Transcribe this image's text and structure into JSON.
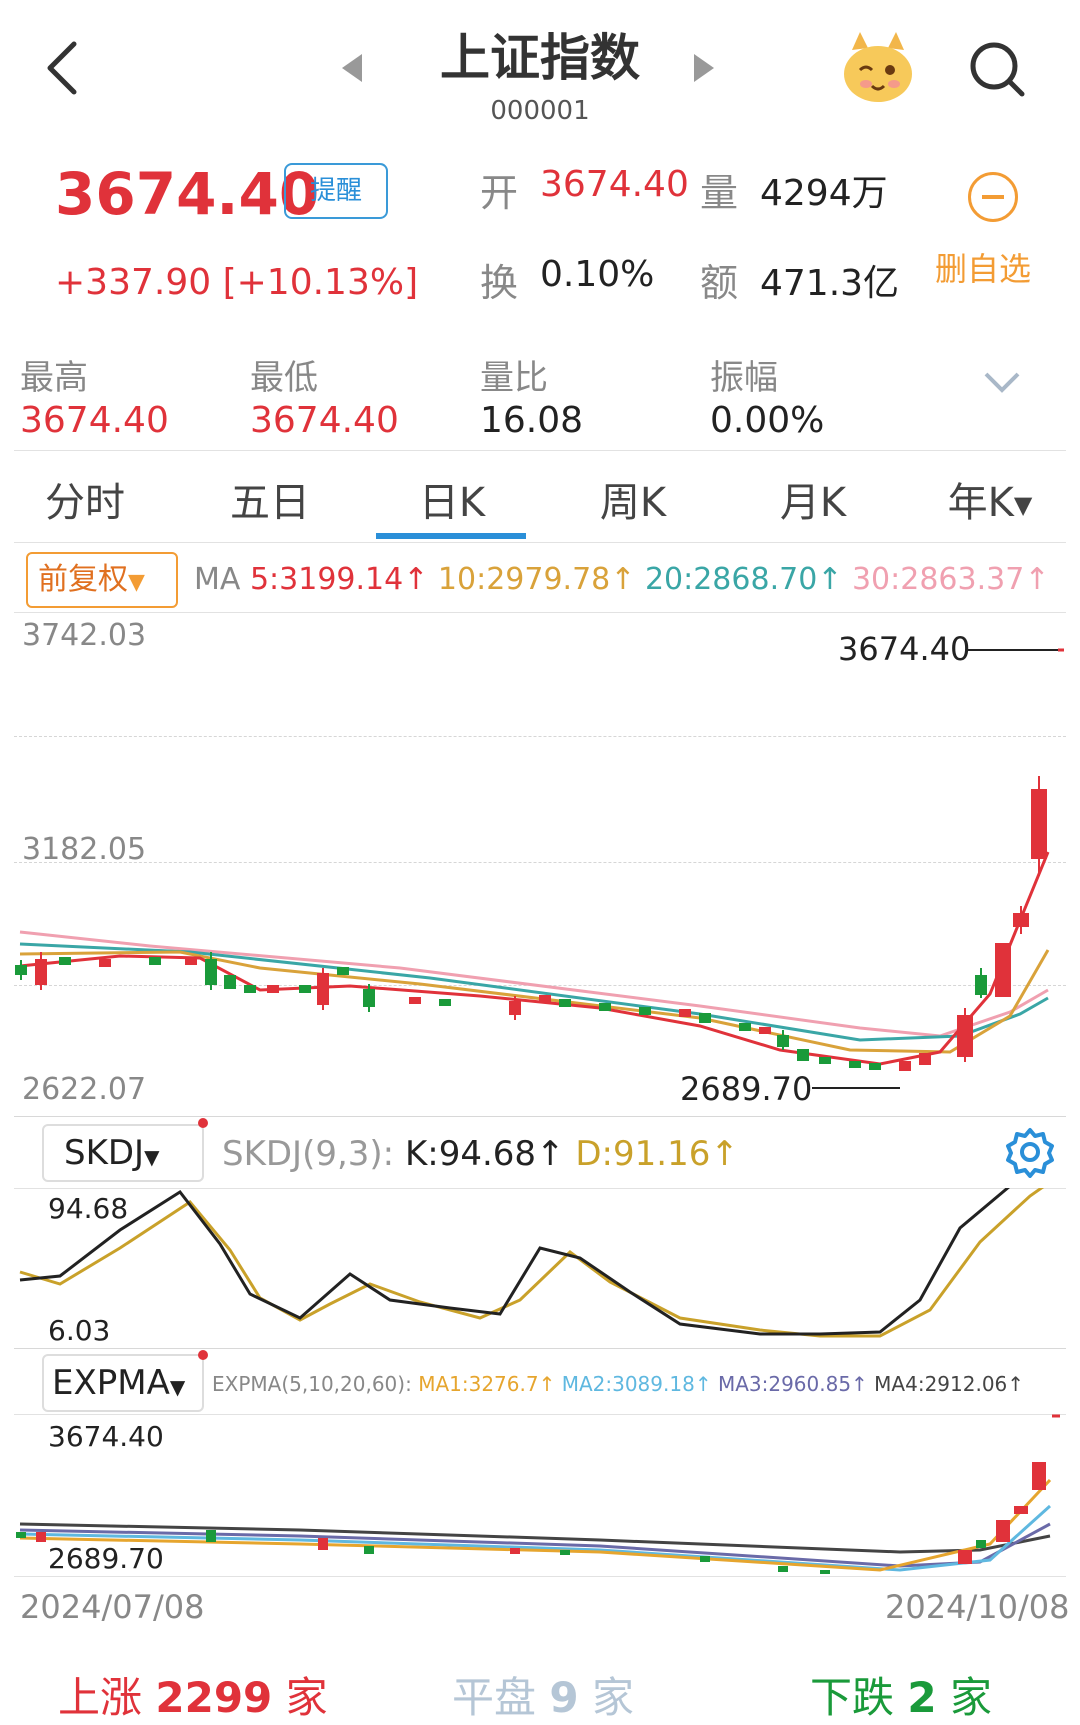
{
  "header": {
    "back_icon": "chevron-left-icon",
    "title": "上证指数",
    "code": "000001",
    "mascot_icon": "cartoon-mascot-icon",
    "search_icon": "search-icon"
  },
  "quote": {
    "price": "3674.40",
    "remind_label": "提醒",
    "change": "+337.90",
    "change_pct": "[+10.13%]",
    "open_label": "开",
    "open_value": "3674.40",
    "volume_label": "量",
    "volume_value": "4294万",
    "turnover_label": "换",
    "turnover_value": "0.10%",
    "amount_label": "额",
    "amount_value": "471.3亿",
    "unwatch_label": "删自选"
  },
  "stats": [
    {
      "label": "最高",
      "value": "3674.40",
      "color": "#e0323a"
    },
    {
      "label": "最低",
      "value": "3674.40",
      "color": "#e0323a"
    },
    {
      "label": "量比",
      "value": "16.08",
      "color": "#222222"
    },
    {
      "label": "振幅",
      "value": "0.00%",
      "color": "#222222"
    }
  ],
  "tabs": [
    {
      "label": "分时"
    },
    {
      "label": "五日"
    },
    {
      "label": "日K",
      "active": true
    },
    {
      "label": "周K"
    },
    {
      "label": "月K"
    },
    {
      "label": "年K"
    }
  ],
  "kline": {
    "adjust_label": "前复权",
    "ma_label": "MA",
    "ma5": "5:3199.14",
    "ma10": "10:2979.78",
    "ma20": "20:2868.70",
    "ma30": "30:2863.37",
    "axis_top": "3742.03",
    "axis_mid": "3182.05",
    "axis_bottom": "2622.07",
    "max_marker": "3674.40",
    "min_marker": "2689.70"
  },
  "skdj": {
    "selector": "SKDJ",
    "params": "SKDJ(9,3):",
    "k": "K:94.68",
    "d": "D:91.16",
    "axis_top": "94.68",
    "axis_bottom": "6.03",
    "settings_icon": "gear-icon"
  },
  "expma": {
    "selector": "EXPMA",
    "params": "EXPMA(5,10,20,60):",
    "ma1": "MA1:3276.7",
    "ma2": "MA2:3089.18",
    "ma3": "MA3:2960.85",
    "ma4": "MA4:2912.06",
    "axis_top": "3674.40",
    "axis_bottom": "2689.70"
  },
  "dates": {
    "start": "2024/07/08",
    "end": "2024/10/08"
  },
  "breadth": {
    "up_prefix": "上涨",
    "up_count": "2299",
    "up_suffix": "家",
    "flat_prefix": "平盘",
    "flat_count": "9",
    "flat_suffix": "家",
    "down_prefix": "下跌",
    "down_count": "2",
    "down_suffix": "家"
  },
  "colors": {
    "up": "#e0323a",
    "down": "#1a9a3a",
    "accent": "#2a8fd8",
    "orange": "#f39c34",
    "ma5": "#e0323a",
    "ma10": "#d9a23a",
    "ma20": "#3aa6a6",
    "ma30": "#f0a0b0"
  }
}
